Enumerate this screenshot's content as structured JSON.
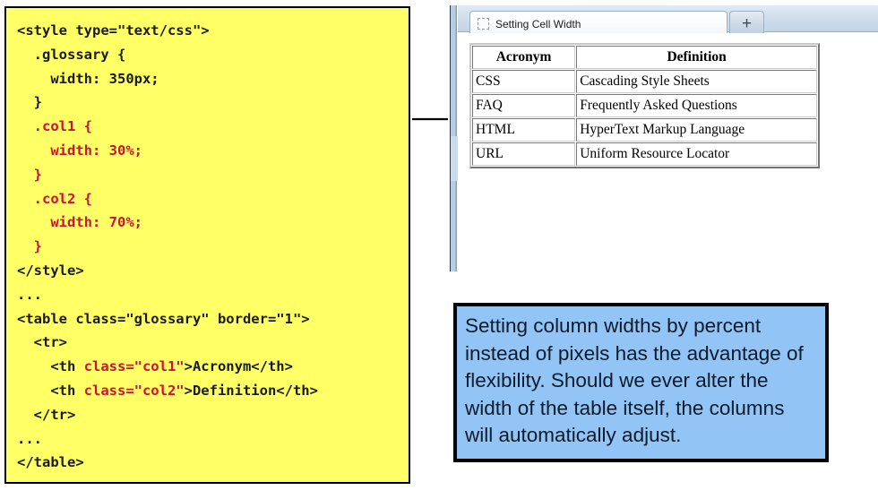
{
  "code_panel": {
    "language": "html-css",
    "background_color": "#ffff66",
    "keyword_color": "#cc1133",
    "lines": [
      [
        {
          "t": "<style type=\"text/css\">",
          "c": "plain"
        }
      ],
      [
        {
          "t": "  .glossary {",
          "c": "plain"
        }
      ],
      [
        {
          "t": "    width: 350px;",
          "c": "plain"
        }
      ],
      [
        {
          "t": "  }",
          "c": "plain"
        }
      ],
      [
        {
          "t": "  .col1 {",
          "c": "red"
        }
      ],
      [
        {
          "t": "    width: 30%;",
          "c": "red"
        }
      ],
      [
        {
          "t": "  }",
          "c": "red"
        }
      ],
      [
        {
          "t": "  .col2 {",
          "c": "red"
        }
      ],
      [
        {
          "t": "    width: 70%;",
          "c": "red"
        }
      ],
      [
        {
          "t": "  }",
          "c": "red"
        }
      ],
      [
        {
          "t": "</style>",
          "c": "plain"
        }
      ],
      [
        {
          "t": "...",
          "c": "plain"
        }
      ],
      [
        {
          "t": "<table class=\"glossary\" border=\"1\">",
          "c": "plain"
        }
      ],
      [
        {
          "t": "  <tr>",
          "c": "plain"
        }
      ],
      [
        {
          "t": "    <th ",
          "c": "plain"
        },
        {
          "t": "class=\"col1\"",
          "c": "red"
        },
        {
          "t": ">Acronym</th>",
          "c": "plain"
        }
      ],
      [
        {
          "t": "    <th ",
          "c": "plain"
        },
        {
          "t": "class=\"col2\"",
          "c": "red"
        },
        {
          "t": ">Definition</th>",
          "c": "plain"
        }
      ],
      [
        {
          "t": "  </tr>",
          "c": "plain"
        }
      ],
      [
        {
          "t": "...",
          "c": "plain"
        }
      ],
      [
        {
          "t": "</table>",
          "c": "plain"
        }
      ]
    ]
  },
  "browser": {
    "tab": {
      "title": "Setting Cell Width",
      "favicon": "blank-page-icon"
    },
    "new_tab_label": "+"
  },
  "page": {
    "table": {
      "headers": [
        "Acronym",
        "Definition"
      ],
      "rows": [
        [
          "CSS",
          "Cascading Style Sheets"
        ],
        [
          "FAQ",
          "Frequently Asked Questions"
        ],
        [
          "HTML",
          "HyperText Markup Language"
        ],
        [
          "URL",
          "Uniform Resource Locator"
        ]
      ]
    }
  },
  "callout": {
    "background_color": "#92c5f5",
    "text": "Setting column widths by percent instead of pixels has the advantage of flexibility.  Should we ever alter the width of the table itself, the columns will automatically adjust."
  }
}
